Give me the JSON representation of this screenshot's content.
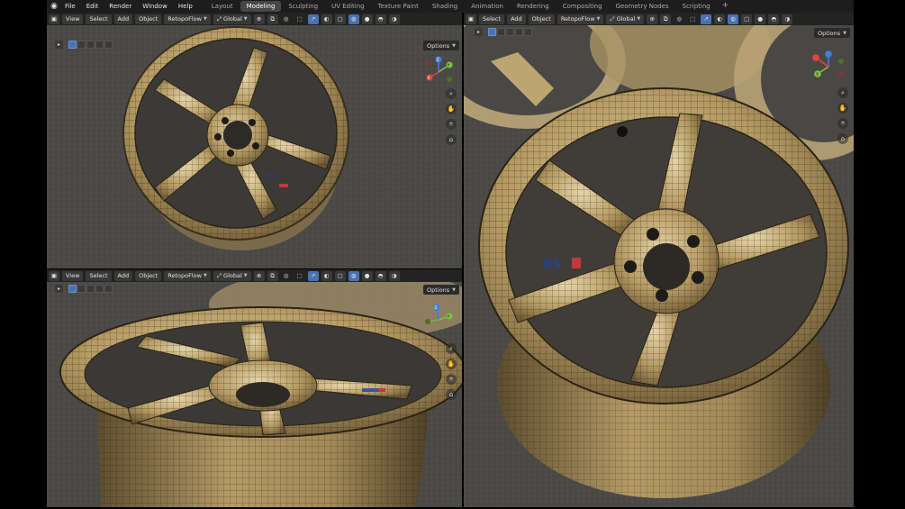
{
  "app": {
    "menus": [
      "File",
      "Edit",
      "Render",
      "Window",
      "Help"
    ],
    "workspaces": [
      "Layout",
      "Modeling",
      "Sculpting",
      "UV Editing",
      "Texture Paint",
      "Shading",
      "Animation",
      "Rendering",
      "Compositing",
      "Geometry Nodes",
      "Scripting"
    ],
    "active_workspace": "Modeling",
    "add_workspace": "+"
  },
  "viewport_header": {
    "view": "View",
    "select": "Select",
    "add": "Add",
    "object": "Object",
    "addon": "RetopoFlow",
    "transform_orientation": "Global",
    "options": "Options"
  },
  "icons": [
    "blender-logo-icon",
    "editor-type-icon",
    "select-box-icon",
    "pivot-icon",
    "snap-icon",
    "proportional-icon",
    "overlay-icon",
    "xray-icon",
    "shading-solid-icon",
    "zoom-icon",
    "pan-hand-icon",
    "camera-icon",
    "lock-icon"
  ],
  "gizmo": {
    "x_label": "X",
    "y_label": "Y",
    "z_label": "Z",
    "x_color": "#e0453f",
    "y_color": "#7ec242",
    "z_color": "#3f7fe0"
  },
  "colors": {
    "accent": "#4772b3",
    "header_bg": "#232323",
    "topbar_bg": "#1d1d1d",
    "rim_gold": "#c2ab7a"
  },
  "decal_text": "RS"
}
